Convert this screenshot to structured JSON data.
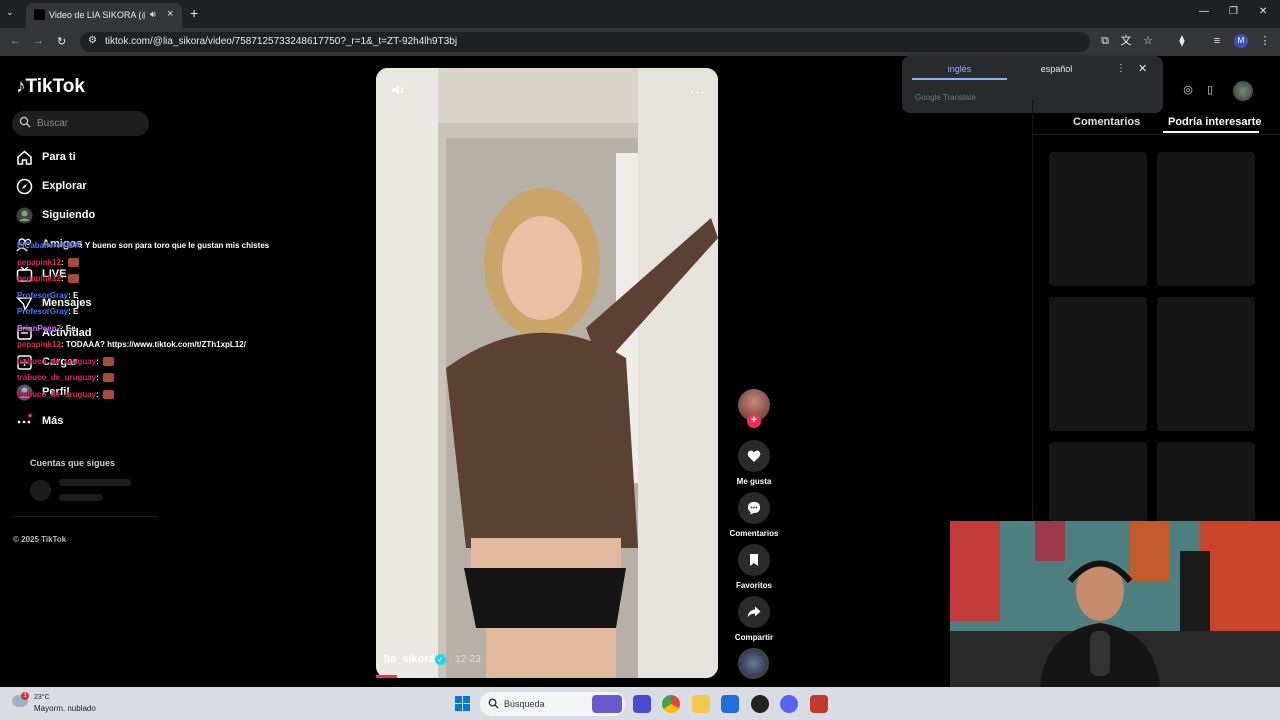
{
  "browser": {
    "tab_title": "Video de LIA SIKORA (@lia_sikora)",
    "tab_close": "×",
    "new_tab": "+",
    "url": "tiktok.com/@lia_sikora/video/7587125733248617750?_r=1&_t=ZT-92h4lh9T3bj",
    "window_min": "—",
    "window_max": "❐",
    "window_close": "✕"
  },
  "sidebar": {
    "logo": "TikTok",
    "search_placeholder": "Buscar",
    "items": [
      {
        "label": "Para ti"
      },
      {
        "label": "Explorar"
      },
      {
        "label": "Siguiendo"
      },
      {
        "label": "Amigos"
      },
      {
        "label": "LIVE"
      },
      {
        "label": "Mensajes"
      },
      {
        "label": "Actividad"
      },
      {
        "label": "Cargar"
      },
      {
        "label": "Perfil"
      },
      {
        "label": "Más"
      }
    ],
    "following_title": "Cuentas que sigues",
    "copyright": "© 2025 TikTok"
  },
  "chat": [
    {
      "user": "ElCaballeroVIDA",
      "text": ": Y bueno son para toro que le gustan mis chistes",
      "color": "#3b7bff"
    },
    {
      "user": "pepapink12",
      "text": ":",
      "color": "#e0245e",
      "emote": true
    },
    {
      "user": "pepapink12",
      "text": ":",
      "color": "#e0245e",
      "emote": true
    },
    {
      "user": "ProfesorGray",
      "text": ": E",
      "color": "#3b7bff"
    },
    {
      "user": "ProfesorGray",
      "text": ": E",
      "color": "#3b7bff"
    },
    {
      "user": "BrianPeep7",
      "text": ": Ee",
      "color": "#d070ff"
    },
    {
      "user": "pepapink12",
      "text": ": TODAAA? https://www.tiktok.com/t/ZTh1xpL12/",
      "color": "#e0245e"
    },
    {
      "user": "trabuco_de_uruguay",
      "text": ":",
      "color": "#e0245e",
      "emote": true
    },
    {
      "user": "trabuco_de_uruguay",
      "text": ":",
      "color": "#e0245e",
      "emote": true
    },
    {
      "user": "trabuco_de_uruguay",
      "text": ":",
      "color": "#e0245e",
      "emote": true
    }
  ],
  "video": {
    "author": "lia_sikora",
    "date": "· 12-23",
    "more": "···",
    "progress": 0.06
  },
  "actions": {
    "follow_plus": "+",
    "like": "Me gusta",
    "comments": "Comentarios",
    "favorites": "Favoritos",
    "share": "Compartir"
  },
  "translate": {
    "lang_source": "inglés",
    "lang_target": "español",
    "more": "⋮",
    "close": "✕",
    "provider": "Google Translate"
  },
  "right_panel": {
    "tab_comments": "Comentarios",
    "tab_suggested": "Podría interesarte"
  },
  "taskbar": {
    "weather_temp": "23°C",
    "weather_desc": "Mayorm. nublado",
    "weather_badge": "1",
    "search_placeholder": "Búsqueda"
  },
  "colors": {
    "accent": "#fe2c55",
    "verified": "#20d5ec",
    "translate_accent": "#8ab4f8"
  }
}
